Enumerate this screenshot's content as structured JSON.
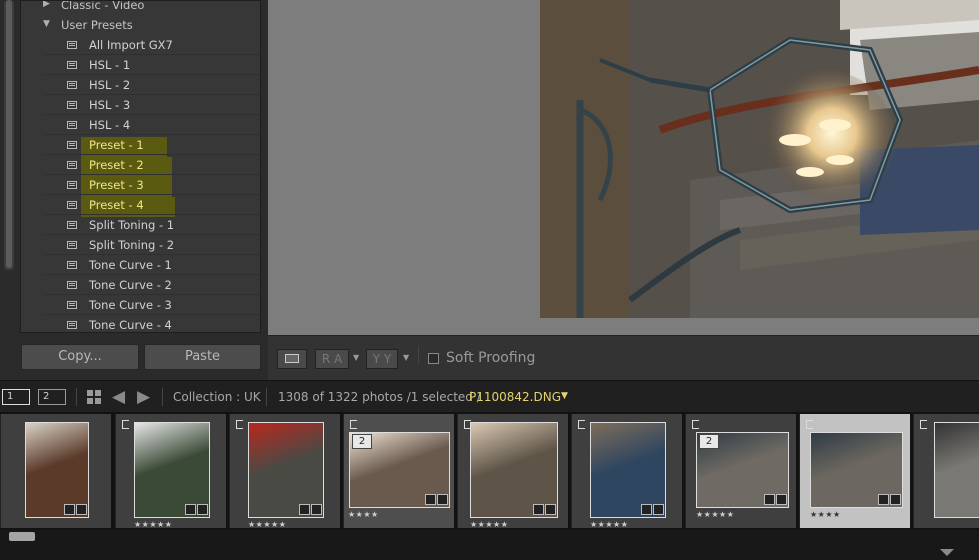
{
  "presets_panel": {
    "folders": [
      {
        "label": "Classic - Video",
        "expanded": false
      },
      {
        "label": "User Presets",
        "expanded": true
      }
    ],
    "items": [
      {
        "label": "All Import GX7",
        "highlighted": false
      },
      {
        "label": "HSL - 1",
        "highlighted": false
      },
      {
        "label": "HSL - 2",
        "highlighted": false
      },
      {
        "label": "HSL - 3",
        "highlighted": false
      },
      {
        "label": "HSL - 4",
        "highlighted": false
      },
      {
        "label": "Preset - 1",
        "highlighted": true
      },
      {
        "label": "Preset - 2",
        "highlighted": true
      },
      {
        "label": "Preset - 3",
        "highlighted": true
      },
      {
        "label": "Preset - 4",
        "highlighted": true
      },
      {
        "label": "Split Toning - 1",
        "highlighted": false
      },
      {
        "label": "Split Toning - 2",
        "highlighted": false
      },
      {
        "label": "Tone Curve - 1",
        "highlighted": false
      },
      {
        "label": "Tone Curve - 2",
        "highlighted": false
      },
      {
        "label": "Tone Curve - 3",
        "highlighted": false
      },
      {
        "label": "Tone Curve - 4",
        "highlighted": false
      }
    ],
    "copy_button": "Copy...",
    "paste_button": "Paste"
  },
  "toolbar": {
    "compare_label": "R A",
    "survey_label": "Y Y",
    "soft_proofing_label": "Soft Proofing",
    "soft_proofing_checked": false
  },
  "filmstrip_nav": {
    "view1": "1",
    "view2": "2",
    "collection": "Collection : UK",
    "count": "1308 of 1322 photos /1 selected /",
    "filename": "P1100842.DNG"
  },
  "filmstrip": [
    {
      "stars": "",
      "badge": "",
      "flag": false,
      "selected": false
    },
    {
      "stars": "★★★★★",
      "badge": "",
      "flag": true,
      "selected": false
    },
    {
      "stars": "★★★★★",
      "badge": "",
      "flag": true,
      "selected": false
    },
    {
      "stars": "★★★★",
      "badge": "2",
      "flag": true,
      "selected": false
    },
    {
      "stars": "★★★★★",
      "badge": "",
      "flag": true,
      "selected": false
    },
    {
      "stars": "★★★★★",
      "badge": "",
      "flag": true,
      "selected": false
    },
    {
      "stars": "★★★★★",
      "badge": "2",
      "flag": true,
      "selected": false
    },
    {
      "stars": "★★★★",
      "badge": "",
      "flag": true,
      "selected": true
    },
    {
      "stars": "",
      "badge": "",
      "flag": true,
      "selected": false
    }
  ],
  "colors": {
    "highlight": "#f0e68c",
    "filename": "#e6d36a",
    "panel": "#373737"
  }
}
